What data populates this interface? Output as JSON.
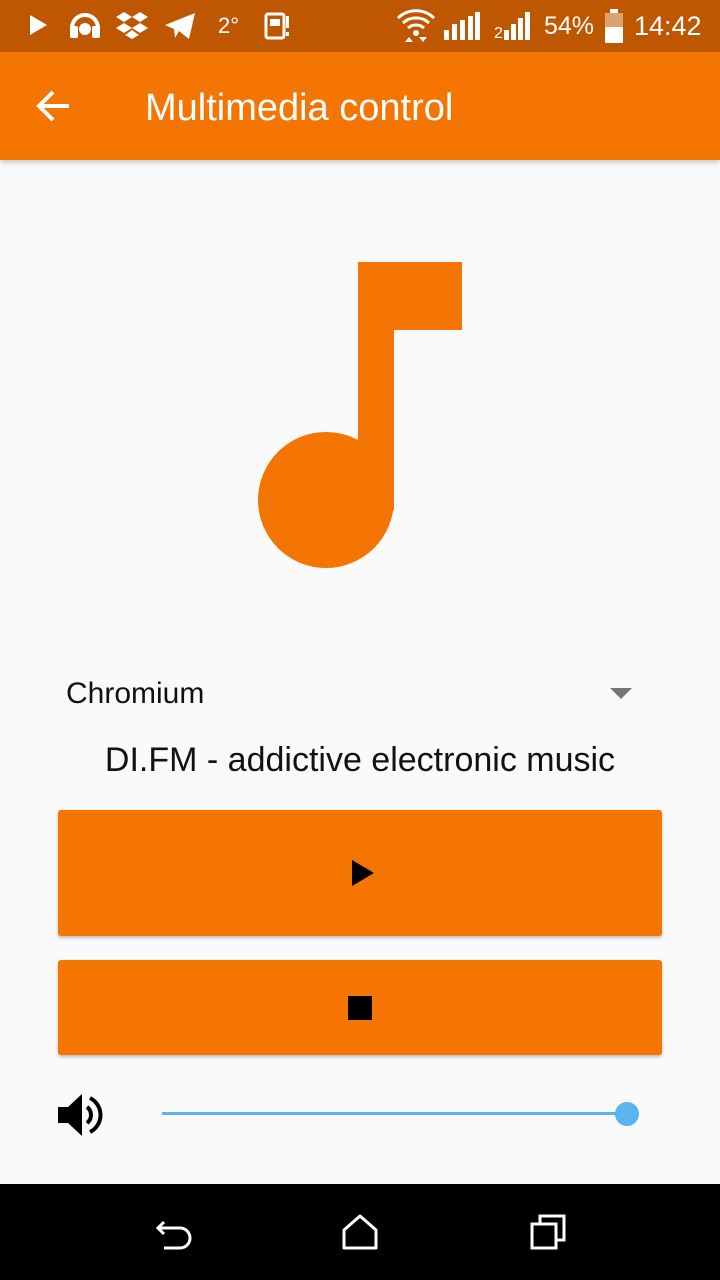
{
  "status_bar": {
    "temperature": "2°",
    "battery_percent": "54%",
    "time": "14:42",
    "icons": [
      "play-icon",
      "headphones-icon",
      "dropbox-icon",
      "telegram-icon",
      "sim-icon",
      "wifi-icon",
      "signal-icon",
      "signal-icon",
      "battery-icon"
    ]
  },
  "app_bar": {
    "title": "Multimedia control",
    "back_icon": "arrow-back-icon"
  },
  "artwork": {
    "icon": "music-note-icon",
    "color": "#f57502"
  },
  "player": {
    "selected_player": "Chromium",
    "track_title": "DI.FM - addictive electronic music",
    "play_icon": "play-icon",
    "stop_icon": "stop-icon"
  },
  "volume": {
    "icon": "volume-up-icon",
    "level": 0.98
  },
  "nav_bar": {
    "icons": [
      "back-icon",
      "home-icon",
      "recents-icon"
    ]
  },
  "colors": {
    "status_bar": "#bf5600",
    "accent": "#f57502",
    "slider": "#5ab4f0",
    "background": "#fafafa"
  }
}
